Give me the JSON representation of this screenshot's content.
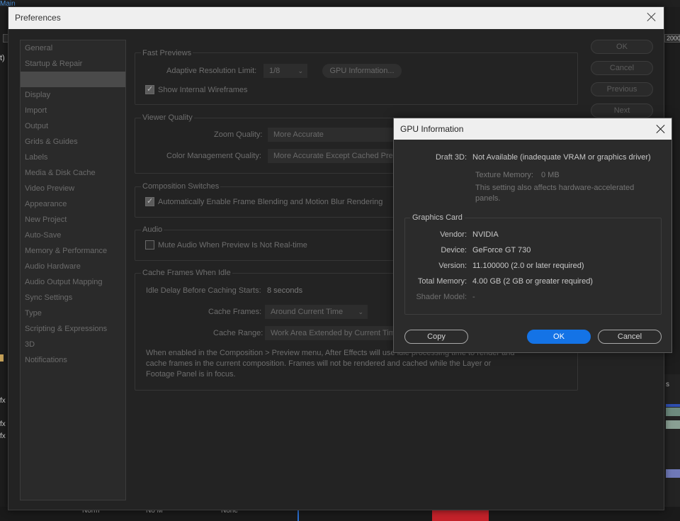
{
  "background": {
    "corner_text": "Main",
    "ruler_right_label": "2000",
    "left_glyph_1": "t)",
    "left_fx_1": "fx",
    "left_fx_2": "fx",
    "left_fx_3": "fx",
    "right_s": "s",
    "bottom_labels": [
      "Norm",
      "No M",
      "None"
    ]
  },
  "preferences": {
    "title": "Preferences",
    "sidebar": [
      {
        "label": "General",
        "selected": false
      },
      {
        "label": "Startup & Repair",
        "selected": false
      },
      {
        "label": "",
        "selected": true
      },
      {
        "label": "Display",
        "selected": false
      },
      {
        "label": "Import",
        "selected": false
      },
      {
        "label": "Output",
        "selected": false
      },
      {
        "label": "Grids & Guides",
        "selected": false
      },
      {
        "label": "Labels",
        "selected": false
      },
      {
        "label": "Media & Disk Cache",
        "selected": false
      },
      {
        "label": "Video Preview",
        "selected": false
      },
      {
        "label": "Appearance",
        "selected": false
      },
      {
        "label": "New Project",
        "selected": false
      },
      {
        "label": "Auto-Save",
        "selected": false
      },
      {
        "label": "Memory & Performance",
        "selected": false
      },
      {
        "label": "Audio Hardware",
        "selected": false
      },
      {
        "label": "Audio Output Mapping",
        "selected": false
      },
      {
        "label": "Sync Settings",
        "selected": false
      },
      {
        "label": "Type",
        "selected": false
      },
      {
        "label": "Scripting & Expressions",
        "selected": false
      },
      {
        "label": "3D",
        "selected": false
      },
      {
        "label": "Notifications",
        "selected": false
      }
    ],
    "fast_previews": {
      "title": "Fast Previews",
      "adaptive_label": "Adaptive Resolution Limit:",
      "adaptive_value": "1/8",
      "gpu_info_button": "GPU Information...",
      "show_wireframes": "Show Internal Wireframes"
    },
    "viewer_quality": {
      "title": "Viewer Quality",
      "zoom_label": "Zoom Quality:",
      "zoom_value": "More Accurate",
      "color_label": "Color Management Quality:",
      "color_value": "More Accurate Except Cached Previ"
    },
    "composition_switches": {
      "title": "Composition Switches",
      "auto_enable": "Automatically Enable Frame Blending and Motion Blur Rendering"
    },
    "audio": {
      "title": "Audio",
      "mute": "Mute Audio When Preview Is Not Real-time"
    },
    "cache_frames": {
      "title": "Cache Frames When Idle",
      "idle_label": "Idle Delay Before Caching Starts:",
      "idle_value": "8 seconds",
      "frames_label": "Cache Frames:",
      "frames_value": "Around Current Time",
      "range_label": "Cache Range:",
      "range_value": "Work Area Extended by Current Tim",
      "description_1": "When enabled in the Composition > Preview menu, After Effects will use idle processing time to render and",
      "description_2": "cache frames in the current composition. Frames will not be rendered and cached while the Layer or",
      "description_3": "Footage Panel is in focus."
    },
    "buttons": {
      "ok": "OK",
      "cancel": "Cancel",
      "previous": "Previous",
      "next": "Next"
    }
  },
  "gpu_dialog": {
    "title": "GPU Information",
    "draft3d_label": "Draft 3D:",
    "draft3d_value": "Not Available (inadequate VRAM or graphics driver)",
    "texture_label": "Texture Memory:",
    "texture_value": "0 MB",
    "note_1": "This setting also affects hardware-accelerated",
    "note_2": "panels.",
    "graphics_card_title": "Graphics Card",
    "vendor_label": "Vendor:",
    "vendor_value": "NVIDIA",
    "device_label": "Device:",
    "device_value": "GeForce GT 730",
    "version_label": "Version:",
    "version_value": "11.100000 (2.0 or later required)",
    "total_label": "Total Memory:",
    "total_value": "4.00 GB (2 GB or greater required)",
    "shader_label": "Shader Model:",
    "shader_value": "-",
    "copy_button": "Copy",
    "ok_button": "OK",
    "cancel_button": "Cancel"
  }
}
